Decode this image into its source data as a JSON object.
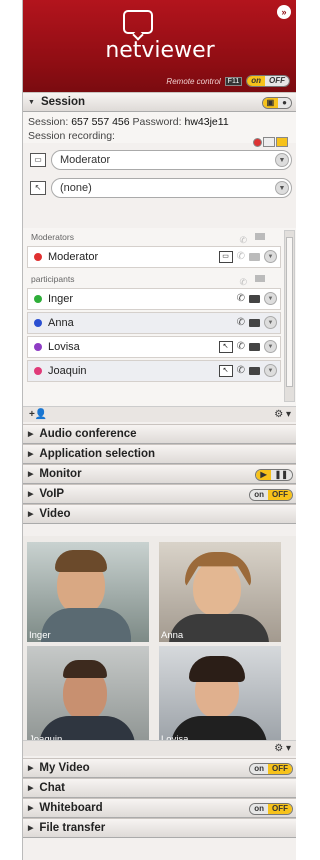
{
  "header": {
    "brand": "netviewer",
    "remote_label": "Remote control",
    "f11": "F11",
    "on": "on",
    "off": "OFF"
  },
  "session": {
    "title": "Session",
    "id_label": "Session:",
    "id": "657 557 456",
    "pw_label": "Password:",
    "pw": "hw43je11",
    "recording_label": "Session recording:",
    "presenter": "Moderator",
    "control": "(none)",
    "moderators_label": "Moderators",
    "participants_label": "participants",
    "moderators": [
      {
        "name": "Moderator",
        "color": "#e03030"
      }
    ],
    "participants": [
      {
        "name": "Inger",
        "color": "#2eae39"
      },
      {
        "name": "Anna",
        "color": "#2b4fd1"
      },
      {
        "name": "Lovisa",
        "color": "#8e3cc4"
      },
      {
        "name": "Joaquin",
        "color": "#e03a78"
      }
    ],
    "add_label": "+👤",
    "gear": "⚙ ▾"
  },
  "sections": {
    "audio": "Audio conference",
    "appsel": "Application selection",
    "monitor": "Monitor",
    "voip": "VoIP",
    "video": "Video",
    "myvideo": "My Video",
    "chat": "Chat",
    "whiteboard": "Whiteboard",
    "filetransfer": "File transfer"
  },
  "video": {
    "tiles": [
      "Inger",
      "Anna",
      "Joaquin",
      "Lovisa"
    ]
  },
  "colors": {
    "brand": "#a11118",
    "accent": "#f6c21b"
  }
}
